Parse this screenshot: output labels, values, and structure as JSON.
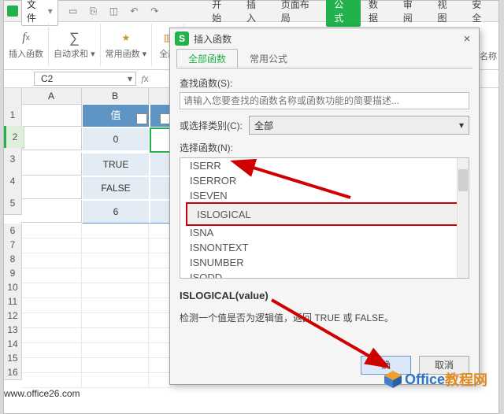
{
  "menubar": {
    "file": "文件",
    "items": [
      "开始",
      "插入",
      "页面布局",
      "公式",
      "数据",
      "审阅",
      "视图",
      "安全"
    ],
    "active_index": 3
  },
  "ribbon": {
    "insert_fn": "插入函数",
    "autosum": "自动求和",
    "common_fn": "常用函数",
    "all": "全部",
    "name_label_cut": "名称"
  },
  "namebox": {
    "value": "C2"
  },
  "grid": {
    "cols": [
      "A",
      "B"
    ],
    "header_cells": [
      "",
      "值",
      ""
    ],
    "rows": [
      {
        "r": "1"
      },
      {
        "r": "2",
        "b": "0"
      },
      {
        "r": "3",
        "b": "TRUE"
      },
      {
        "r": "4",
        "b": "FALSE"
      },
      {
        "r": "5",
        "b": "6"
      }
    ],
    "small_rows": [
      "6",
      "7",
      "8",
      "9",
      "10",
      "11",
      "12",
      "13",
      "14",
      "15",
      "16"
    ]
  },
  "dialog": {
    "title": "插入函数",
    "tabs": [
      "全部函数",
      "常用公式"
    ],
    "search_label": "查找函数(S):",
    "search_placeholder": "请输入您要查找的函数名称或函数功能的简要描述...",
    "category_label": "或选择类别(C):",
    "category_value": "全部",
    "list_label": "选择函数(N):",
    "functions": [
      "ISERR",
      "ISERROR",
      "ISEVEN",
      "ISLOGICAL",
      "ISNA",
      "ISNONTEXT",
      "ISNUMBER",
      "ISODD"
    ],
    "selected_index": 3,
    "signature": "ISLOGICAL(value)",
    "description": "检测一个值是否为逻辑值，返回 TRUE 或 FALSE。",
    "ok": "确",
    "cancel": "取消"
  },
  "watermark": {
    "brand1": "Office",
    "brand2": "教程网",
    "url": "www.office26.com"
  }
}
